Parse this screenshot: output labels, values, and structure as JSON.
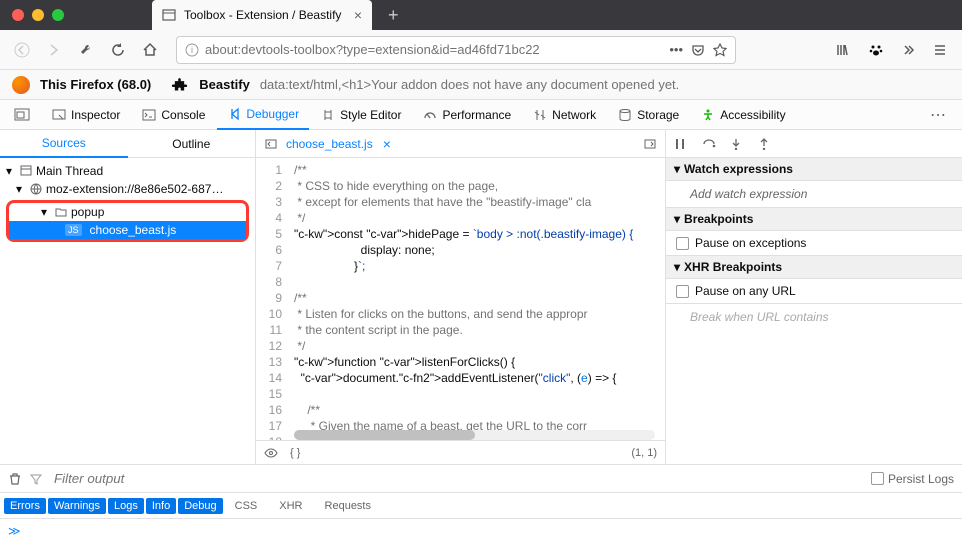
{
  "window": {
    "tab_title": "Toolbox - Extension / Beastify"
  },
  "urlbar": {
    "url": "about:devtools-toolbox?type=extension&id=ad46fd71bc22"
  },
  "identity": {
    "firefox_label": "This Firefox (68.0)",
    "extension_name": "Beastify",
    "extension_desc": "data:text/html,<h1>Your addon does not have any document opened yet."
  },
  "devtools_tabs": {
    "inspector": "Inspector",
    "console": "Console",
    "debugger": "Debugger",
    "style_editor": "Style Editor",
    "performance": "Performance",
    "network": "Network",
    "storage": "Storage",
    "accessibility": "Accessibility"
  },
  "sources": {
    "tab_sources": "Sources",
    "tab_outline": "Outline",
    "main_thread": "Main Thread",
    "origin": "moz-extension://8e86e502-687…",
    "folder": "popup",
    "file": "choose_beast.js",
    "js_badge": "JS"
  },
  "editor": {
    "filename": "choose_beast.js",
    "lines": [
      "/**",
      " * CSS to hide everything on the page,",
      " * except for elements that have the \"beastify-image\" cla",
      " */",
      "const hidePage = `body > :not(.beastify-image) {",
      "                    display: none;",
      "                  }`;",
      "",
      "/**",
      " * Listen for clicks on the buttons, and send the appropr",
      " * the content script in the page.",
      " */",
      "function listenForClicks() {",
      "  document.addEventListener(\"click\", (e) => {",
      "",
      "    /**",
      "     * Given the name of a beast, get the URL to the corr",
      ""
    ],
    "cursor": "(1, 1)",
    "braces": "{ }"
  },
  "right": {
    "watch_hdr": "Watch expressions",
    "watch_placeholder": "Add watch expression",
    "bp_hdr": "Breakpoints",
    "bp_pause": "Pause on exceptions",
    "xhr_hdr": "XHR Breakpoints",
    "xhr_pause": "Pause on any URL",
    "xhr_placeholder": "Break when URL contains"
  },
  "console": {
    "filter_placeholder": "Filter output",
    "persist": "Persist Logs",
    "btn_errors": "Errors",
    "btn_warnings": "Warnings",
    "btn_logs": "Logs",
    "btn_info": "Info",
    "btn_debug": "Debug",
    "txt_css": "CSS",
    "txt_xhr": "XHR",
    "txt_requests": "Requests",
    "prompt": "≫"
  }
}
